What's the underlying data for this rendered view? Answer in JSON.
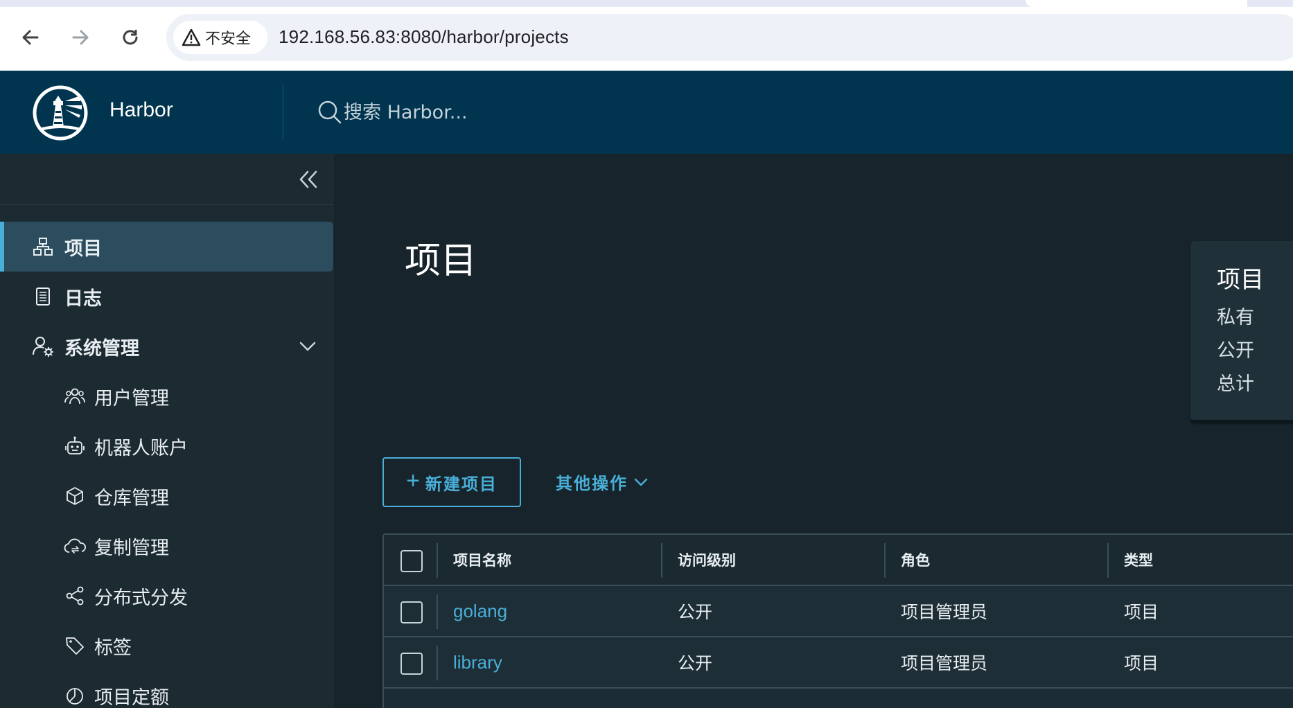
{
  "browser": {
    "security_label": "不安全",
    "url": "192.168.56.83:8080/harbor/projects"
  },
  "header": {
    "brand": "Harbor",
    "search_placeholder": "搜索 Harbor..."
  },
  "sidebar": {
    "items": [
      {
        "label": "项目",
        "icon": "projects-icon",
        "active": true
      },
      {
        "label": "日志",
        "icon": "logs-icon"
      },
      {
        "label": "系统管理",
        "icon": "user-gear-icon",
        "expanded": true
      },
      {
        "label": "用户管理",
        "icon": "users-icon"
      },
      {
        "label": "机器人账户",
        "icon": "robot-icon"
      },
      {
        "label": "仓库管理",
        "icon": "box-icon"
      },
      {
        "label": "复制管理",
        "icon": "cloud-sync-icon"
      },
      {
        "label": "分布式分发",
        "icon": "share-icon"
      },
      {
        "label": "标签",
        "icon": "tag-icon"
      },
      {
        "label": "项目定额",
        "icon": "pie-chart-icon"
      }
    ]
  },
  "main": {
    "title": "项目",
    "summary": {
      "title": "项目",
      "rows": [
        "私有",
        "公开",
        "总计"
      ]
    },
    "new_project_label": "新建项目",
    "other_actions_label": "其他操作",
    "table": {
      "columns": [
        "项目名称",
        "访问级别",
        "角色",
        "类型"
      ],
      "rows": [
        {
          "name": "golang",
          "access": "公开",
          "role": "项目管理员",
          "type": "项目"
        },
        {
          "name": "library",
          "access": "公开",
          "role": "项目管理员",
          "type": "项目"
        }
      ]
    }
  },
  "colors": {
    "header_bg": "#00344f",
    "sidebar_bg": "#1c2a32",
    "main_bg": "#17242b",
    "accent": "#49afd9",
    "active_item_bg": "#2c4d5e"
  }
}
